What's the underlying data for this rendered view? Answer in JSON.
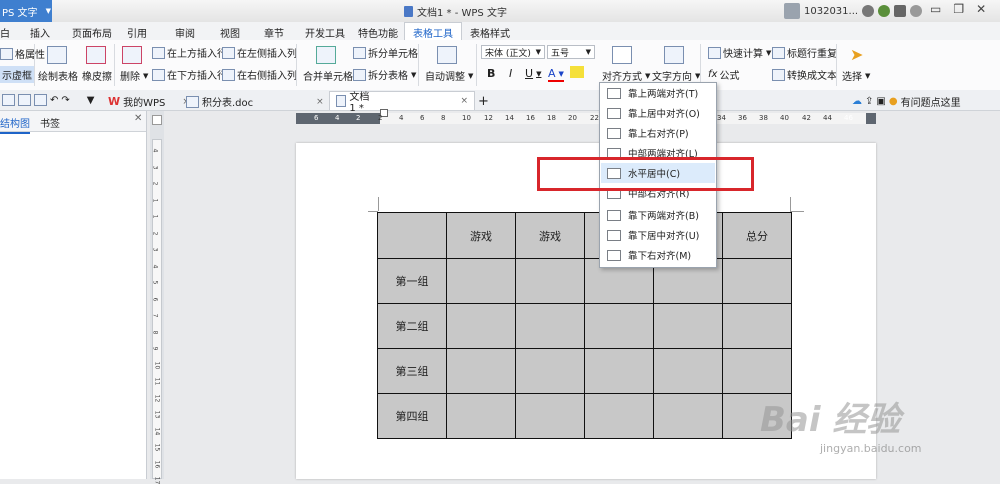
{
  "app": {
    "name": "PS 文字",
    "title": "文档1 * - WPS 文字",
    "user": "1032031..."
  },
  "tabs": [
    "插入",
    "页面布局",
    "引用",
    "审阅",
    "视图",
    "章节",
    "开发工具",
    "特色功能",
    "表格工具",
    "表格样式"
  ],
  "tab_partial": "白",
  "ribbon": {
    "table_props": "格属性",
    "show_border": "示虚框",
    "draw_table": "绘制表格",
    "eraser": "橡皮擦",
    "delete": "删除",
    "insert_above": "在上方插入行",
    "insert_below": "在下方插入行",
    "insert_left": "在左侧插入列",
    "insert_right": "在右侧插入列",
    "merge": "合并单元格",
    "split_cell": "拆分单元格",
    "split_table": "拆分表格",
    "auto_adjust": "自动调整",
    "font": "宋体 (正文)",
    "size": "五号",
    "align": "对齐方式",
    "text_dir": "文字方向",
    "quick_calc": "快速计算",
    "header_repeat": "标题行重复",
    "formula": "公式",
    "to_text": "转换成文本",
    "select": "选择",
    "bold": "B",
    "italic": "I",
    "underline": "U",
    "fontcolor": "A",
    "fx": "fx"
  },
  "doc_tabs": [
    "我的WPS",
    "积分表.doc",
    "文档1 *"
  ],
  "help": "有问题点这里",
  "left_panel": {
    "tab1": "结构图",
    "tab2": "书签"
  },
  "hruler_nums": [
    "6",
    "4",
    "2",
    "2",
    "4",
    "6",
    "8",
    "10",
    "12",
    "14",
    "16",
    "18",
    "20",
    "22",
    "24",
    "26",
    "28",
    "30",
    "32",
    "34",
    "36",
    "38",
    "40",
    "42",
    "44",
    "46"
  ],
  "vruler_nums": [
    "4",
    "3",
    "2",
    "1",
    "1",
    "2",
    "3",
    "4",
    "5",
    "6",
    "7",
    "8",
    "9",
    "10",
    "11",
    "12",
    "13",
    "14",
    "15",
    "16",
    "17"
  ],
  "table": {
    "header": [
      "",
      "游戏",
      "游戏",
      "",
      "",
      "总分"
    ],
    "rows": [
      "第一组",
      "第二组",
      "第三组",
      "第四组"
    ]
  },
  "menu": [
    "靠上两端对齐(T)",
    "靠上居中对齐(O)",
    "靠上右对齐(P)",
    "中部两端对齐(L)",
    "水平居中(C)",
    "中部右对齐(R)",
    "靠下两端对齐(B)",
    "靠下居中对齐(U)",
    "靠下右对齐(M)"
  ],
  "menu_highlight_index": 4,
  "watermark": {
    "text": "Bai  经验",
    "url": "jingyan.baidu.com"
  },
  "colors": {
    "accent": "#3f7fcf",
    "highlight": "#d8262b",
    "table_fill": "#c8c8c8"
  }
}
